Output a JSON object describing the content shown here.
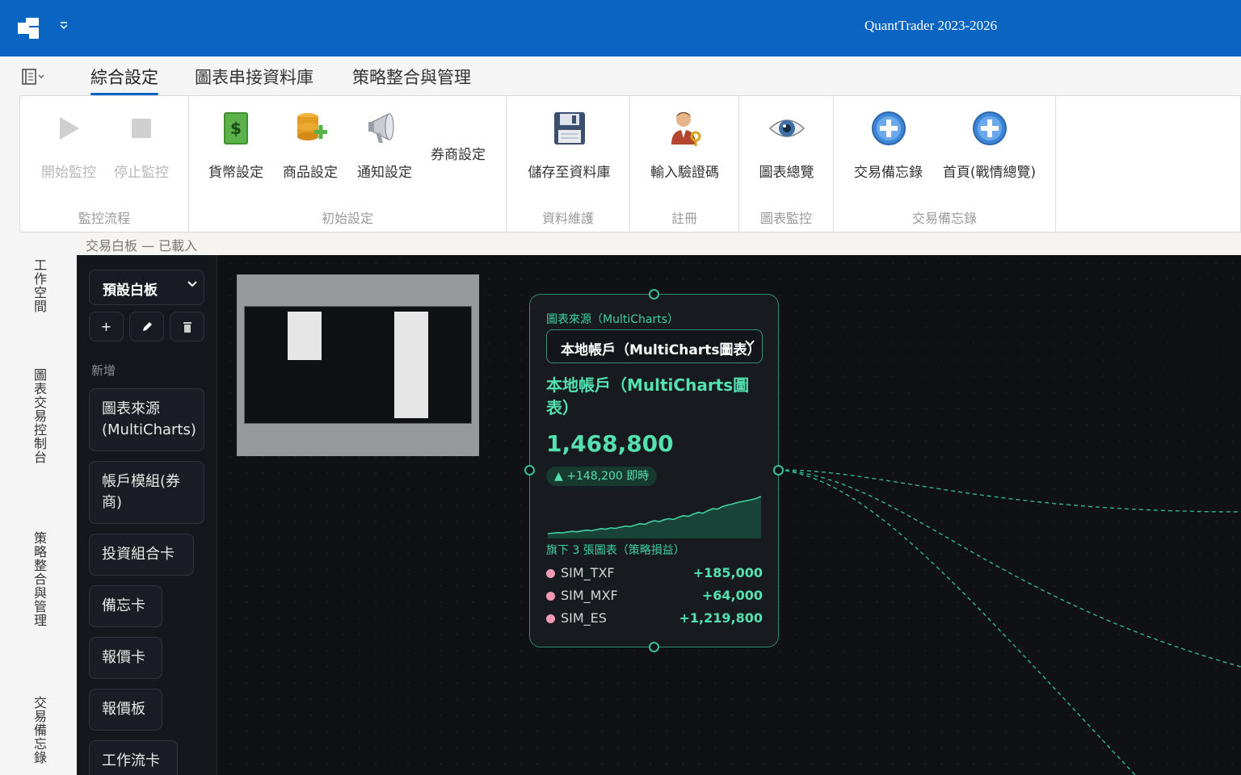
{
  "app": {
    "title": "QuantTrader 2023-2026"
  },
  "tabs": [
    {
      "label": "綜合設定",
      "active": true
    },
    {
      "label": "圖表串接資料庫",
      "active": false
    },
    {
      "label": "策略整合與管理",
      "active": false
    }
  ],
  "ribbon": {
    "groups": {
      "monitor": "監控流程",
      "init": "初始設定",
      "data": "資料維護",
      "register": "註冊",
      "chart": "圖表監控",
      "memo": "交易備忘錄"
    },
    "buttons": {
      "start_monitor": "開始監控",
      "stop_monitor": "停止監控",
      "currency": "貨幣設定",
      "product": "商品設定",
      "notify": "通知設定",
      "broker": "券商設定",
      "save_db": "儲存至資料庫",
      "enter_code": "輸入驗證碼",
      "chart_overview": "圖表總覽",
      "trade_memo": "交易備忘錄",
      "home": "首頁(戰情總覽)"
    }
  },
  "status": {
    "text": "交易白板 — 已載入"
  },
  "leftnav": [
    "工作空間",
    "圖表交易控制台",
    "策略整合與管理",
    "交易備忘錄"
  ],
  "palette": {
    "whiteboard_select": "預設白板",
    "add_label": "新增",
    "tool_icons": [
      "plus-icon",
      "pencil-icon",
      "trash-icon"
    ],
    "items": [
      "圖表來源\n(MultiCharts)",
      "帳戶模組(券\n商)",
      "投資組合卡",
      "備忘卡",
      "報價卡",
      "報價板",
      "工作流卡"
    ]
  },
  "node": {
    "source_label": "圖表來源（MultiCharts）",
    "select_value": "本地帳戶（MultiCharts圖表）",
    "title": "本地帳戶（MultiCharts圖表）",
    "value": "1,468,800",
    "delta": "▲ +148,200 即時",
    "sub_label": "旗下 3 張圖表（策略損益）",
    "charts": [
      {
        "name": "SIM_TXF",
        "pnl": "+185,000"
      },
      {
        "name": "SIM_MXF",
        "pnl": "+64,000"
      },
      {
        "name": "SIM_ES",
        "pnl": "+1,219,800"
      }
    ],
    "sparkline": [
      1320000,
      1322000,
      1324000,
      1323000,
      1326000,
      1329000,
      1327000,
      1331000,
      1334000,
      1332000,
      1336000,
      1340000,
      1338000,
      1343000,
      1341000,
      1346000,
      1350000,
      1348000,
      1354000,
      1360000,
      1357000,
      1366000,
      1372000,
      1368000,
      1376000,
      1380000,
      1377000,
      1386000,
      1392000,
      1389000,
      1398000,
      1405000,
      1402000,
      1412000,
      1420000,
      1418000,
      1428000,
      1434000,
      1438000,
      1444000,
      1448000,
      1452000,
      1456000,
      1461000,
      1468800
    ]
  },
  "colors": {
    "accent": "#0a64c2",
    "green": "#55e0b0",
    "canvas": "#0f1115"
  }
}
